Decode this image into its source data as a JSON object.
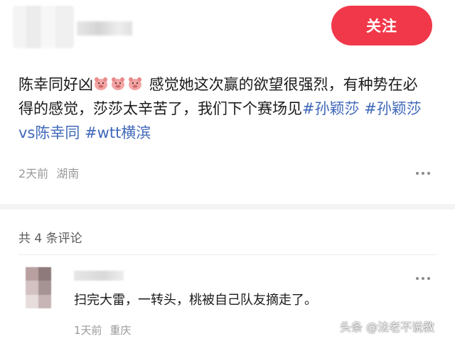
{
  "header": {
    "follow_label": "关注"
  },
  "post": {
    "text_intro": "陈幸同好凶",
    "emoji_name": "pig-face-emoji",
    "text_main": "感觉她这次赢的欲望很强烈，有种势在必得的感觉，莎莎太辛苦了，我们下个赛场见",
    "hashtags": [
      "#孙颖莎",
      "#孙颖莎vs陈幸同",
      "#wtt横滨"
    ],
    "time": "2天前",
    "location": "湖南",
    "more_icon": "ellipsis-icon"
  },
  "comments": {
    "count_label": "共 4 条评论",
    "items": [
      {
        "text": "扫完大雷，一转头，桃被自己队友摘走了。",
        "time": "1天前",
        "location": "重庆"
      }
    ]
  },
  "watermark": "头条 @法老不说教",
  "colors": {
    "accent": "#f1384a",
    "hashtag": "#4068b9",
    "meta": "#9a9a9a"
  }
}
